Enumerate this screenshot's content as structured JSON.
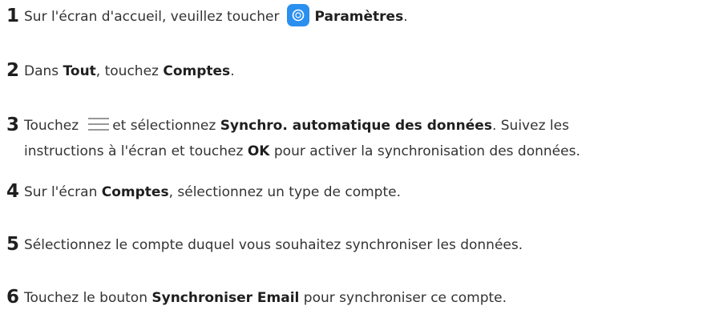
{
  "steps": [
    {
      "number": "1",
      "text_a": "Sur l'écran d'accueil, veuillez toucher",
      "icon": "settings-icon",
      "bold_a": "Paramètres",
      "text_b": "."
    },
    {
      "number": "2",
      "text_a": "Dans ",
      "bold_a": "Tout",
      "text_b": ", touchez ",
      "bold_b": "Comptes",
      "text_c": "."
    },
    {
      "number": "3",
      "text_a": "Touchez",
      "icon": "menu-icon",
      "text_b": "et sélectionnez ",
      "bold_a": "Synchro. automatique des données",
      "text_c": ". Suivez les",
      "line2_a": "instructions à l'écran et touchez ",
      "bold_b": "OK",
      "line2_b": " pour activer la synchronisation des données."
    },
    {
      "number": "4",
      "text_a": "Sur l'écran ",
      "bold_a": "Comptes",
      "text_b": ", sélectionnez un type de compte."
    },
    {
      "number": "5",
      "text_a": "Sélectionnez le compte duquel vous souhaitez synchroniser les données."
    },
    {
      "number": "6",
      "text_a": "Touchez le bouton ",
      "bold_a": "Synchroniser Email",
      "text_b": " pour synchroniser ce compte."
    }
  ],
  "colors": {
    "text": "#333333",
    "number": "#1f1f1f",
    "settings_icon_bg": "#2b8ff0"
  }
}
